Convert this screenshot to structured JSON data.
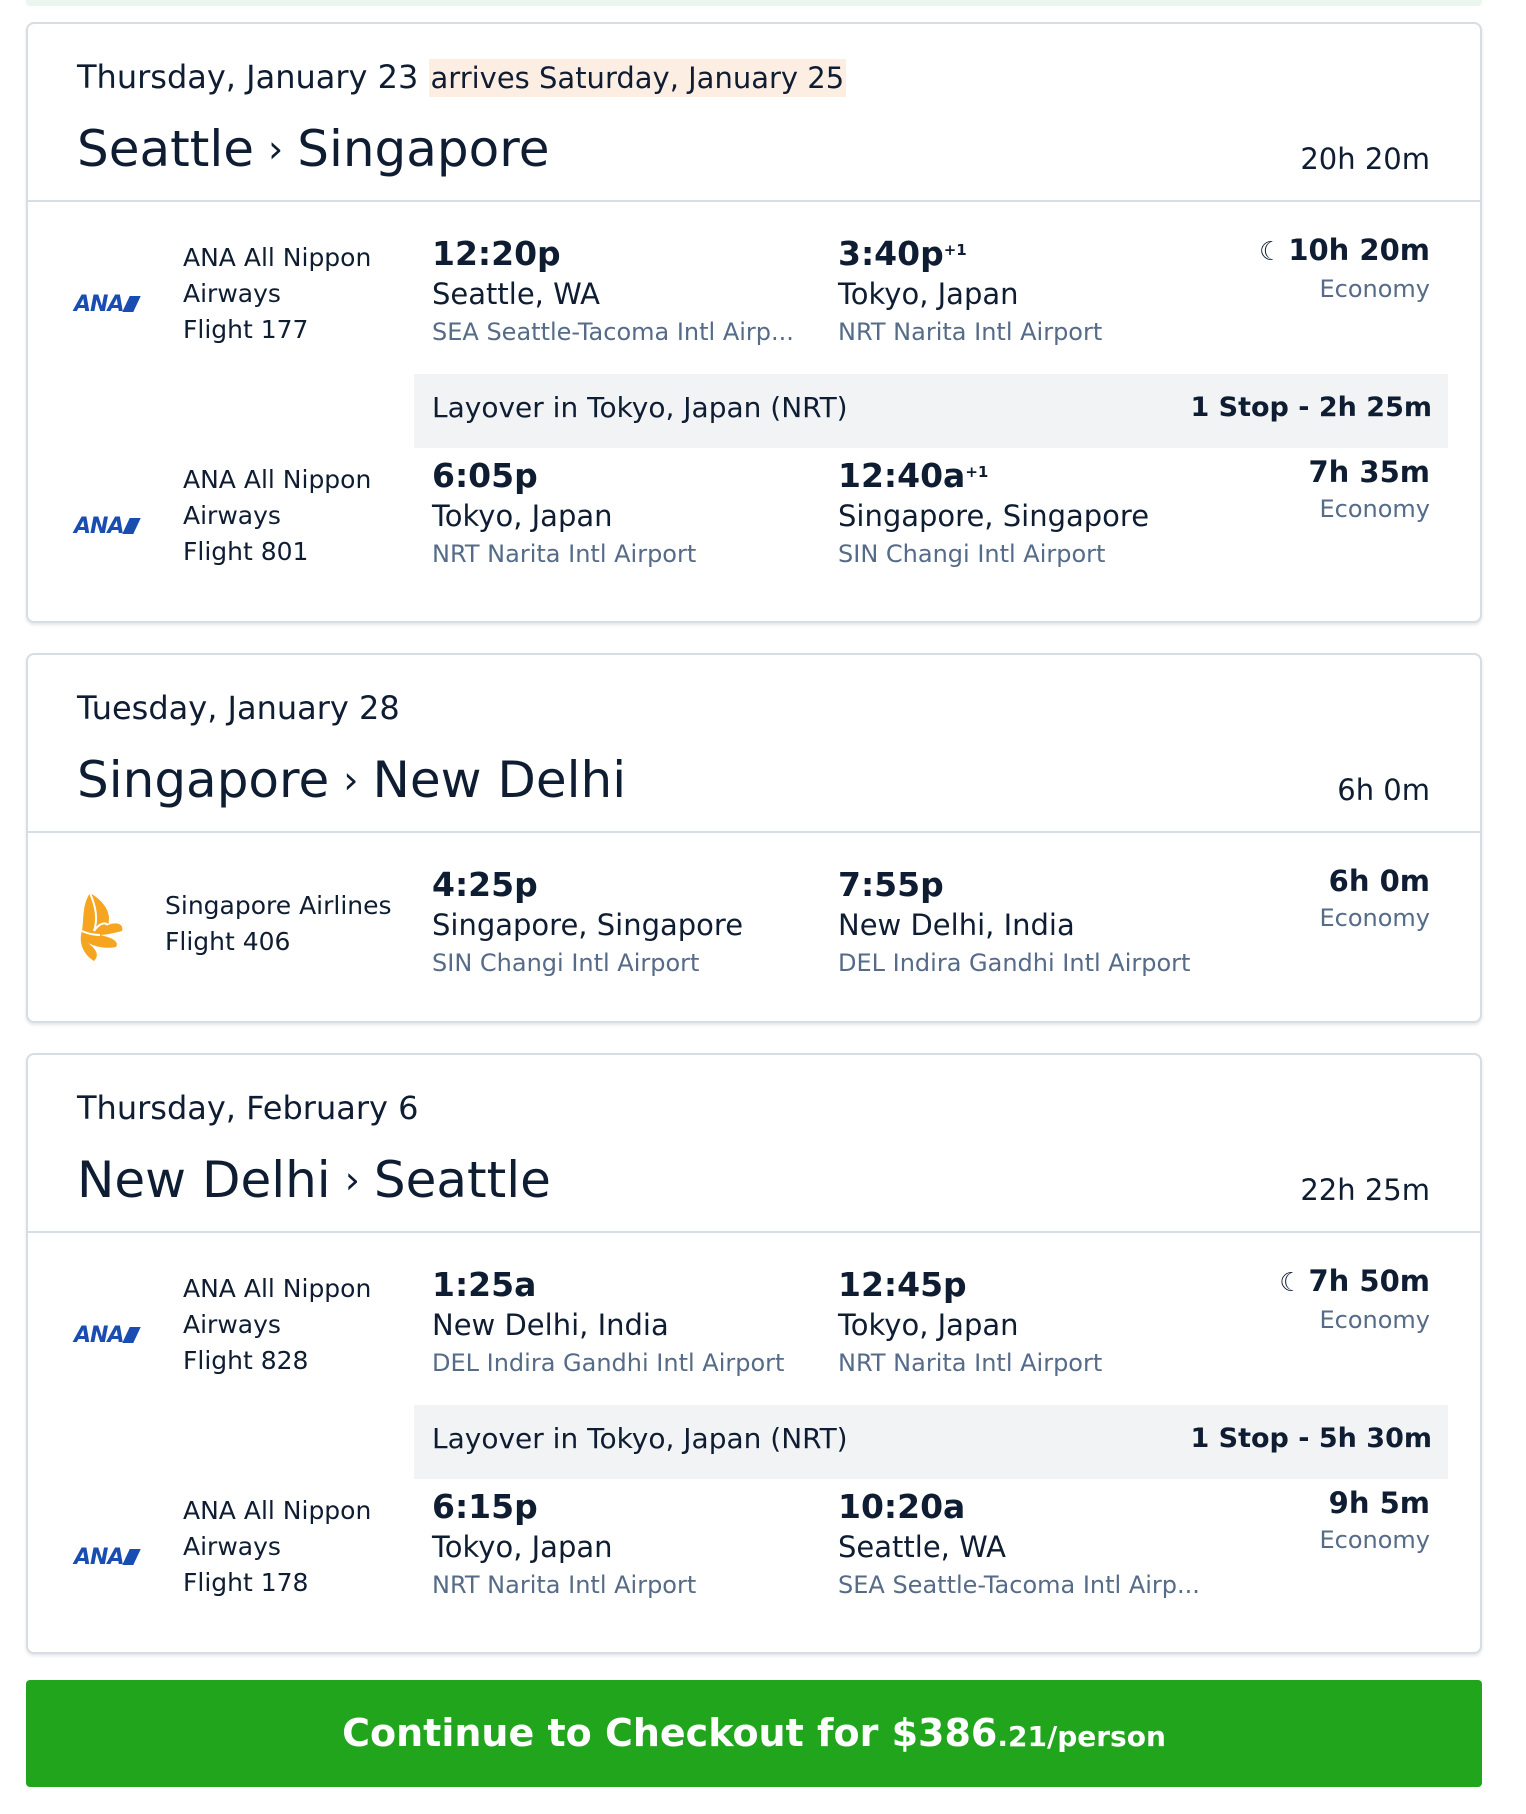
{
  "trips": [
    {
      "date": "Thursday, January 23",
      "arrives": "arrives Saturday, January 25",
      "origin": "Seattle",
      "destination": "Singapore",
      "total_duration": "20h 20m",
      "segments": [
        {
          "airline_logo": "ANA",
          "airline_name": "ANA All Nippon Airways",
          "flight": "Flight 177",
          "dep_time": "12:20p",
          "dep_city": "Seattle, WA",
          "dep_airport": "SEA Seattle-Tacoma Intl Airp...",
          "arr_time": "3:40p",
          "arr_day_offset": "+1",
          "arr_city": "Tokyo, Japan",
          "arr_airport": "NRT Narita Intl Airport",
          "duration": "10h 20m",
          "overnight_icon": "moon-icon",
          "cabin": "Economy"
        },
        {
          "airline_logo": "ANA",
          "airline_name": "ANA All Nippon Airways",
          "flight": "Flight 801",
          "dep_time": "6:05p",
          "dep_city": "Tokyo, Japan",
          "dep_airport": "NRT Narita Intl Airport",
          "arr_time": "12:40a",
          "arr_day_offset": "+1",
          "arr_city": "Singapore, Singapore",
          "arr_airport": "SIN Changi Intl Airport",
          "duration": "7h 35m",
          "cabin": "Economy"
        }
      ],
      "layover": {
        "text": "Layover in Tokyo, Japan (NRT)",
        "stops": "1 Stop - 2h 25m"
      }
    },
    {
      "date": "Tuesday, January 28",
      "origin": "Singapore",
      "destination": "New Delhi",
      "total_duration": "6h 0m",
      "segments": [
        {
          "airline_logo": "singapore-airlines-bird-logo",
          "airline_name": "Singapore Airlines",
          "flight": "Flight 406",
          "dep_time": "4:25p",
          "dep_city": "Singapore, Singapore",
          "dep_airport": "SIN Changi Intl Airport",
          "arr_time": "7:55p",
          "arr_city": "New Delhi, India",
          "arr_airport": "DEL Indira Gandhi Intl Airport",
          "duration": "6h 0m",
          "cabin": "Economy"
        }
      ]
    },
    {
      "date": "Thursday, February 6",
      "origin": "New Delhi",
      "destination": "Seattle",
      "total_duration": "22h 25m",
      "segments": [
        {
          "airline_logo": "ANA",
          "airline_name": "ANA All Nippon Airways",
          "flight": "Flight 828",
          "dep_time": "1:25a",
          "dep_city": "New Delhi, India",
          "dep_airport": "DEL Indira Gandhi Intl Airport",
          "arr_time": "12:45p",
          "arr_city": "Tokyo, Japan",
          "arr_airport": "NRT Narita Intl Airport",
          "duration": "7h 50m",
          "overnight_icon": "moon-icon",
          "cabin": "Economy"
        },
        {
          "airline_logo": "ANA",
          "airline_name": "ANA All Nippon Airways",
          "flight": "Flight 178",
          "dep_time": "6:15p",
          "dep_city": "Tokyo, Japan",
          "dep_airport": "NRT Narita Intl Airport",
          "arr_time": "10:20a",
          "arr_city": "Seattle, WA",
          "arr_airport": "SEA Seattle-Tacoma Intl Airp...",
          "duration": "9h 5m",
          "cabin": "Economy"
        }
      ],
      "layover": {
        "text": "Layover in Tokyo, Japan (NRT)",
        "stops": "1 Stop - 5h 30m"
      }
    }
  ],
  "checkout": {
    "label": "Continue to Checkout for $386",
    "cents": ".21",
    "per": "/person",
    "color": "#21a51c"
  },
  "colors": {
    "text": "#0f1d33",
    "muted": "#556b88",
    "ana_blue": "#1a4db1",
    "sq_gold": "#f6a520",
    "arrives_bg": "#fdeee4"
  }
}
